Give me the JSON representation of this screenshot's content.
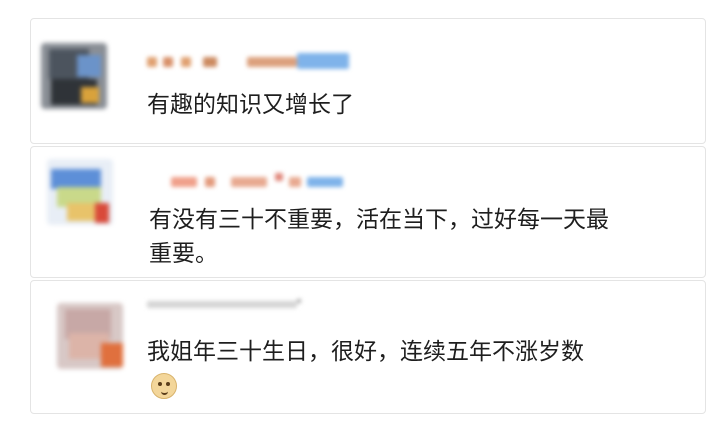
{
  "comments": [
    {
      "text": "有趣的知识又增长了"
    },
    {
      "text_line1": "有没有三十不重要，活在当下，过好每一天最",
      "text_line2": "重要。"
    },
    {
      "text": "我姐年三十生日，很好，连续五年不涨岁数",
      "emoji": "doge-icon"
    }
  ]
}
